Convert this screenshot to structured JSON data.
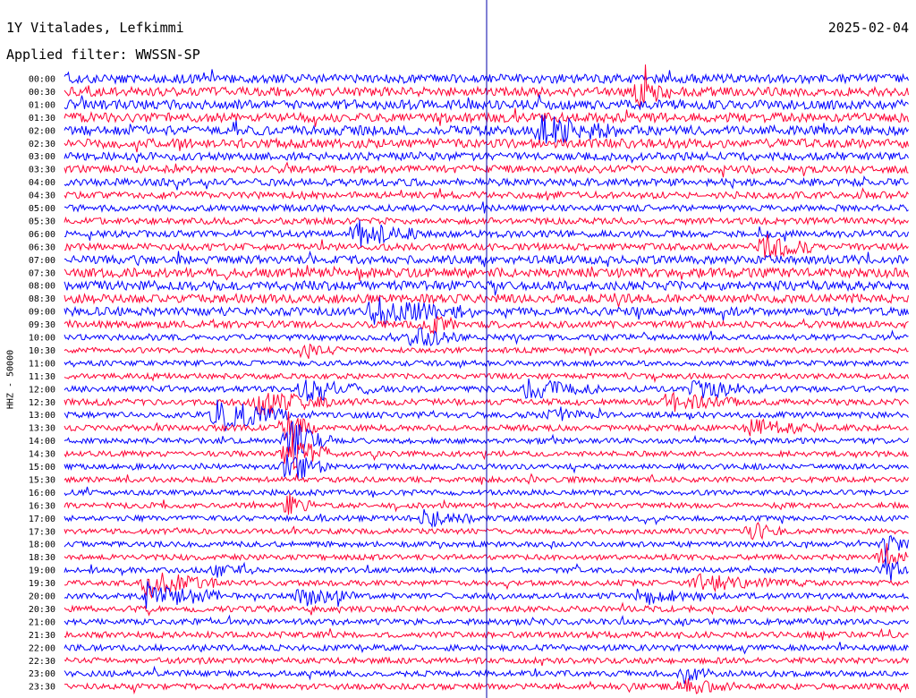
{
  "header": {
    "station": "1Y Vitalades, Lefkimmi",
    "date": "2025-02-04",
    "filter": "Applied filter: WWSSN-SP"
  },
  "chart_data": {
    "type": "line",
    "title": "1Y Vitalades, Lefkimmi",
    "ylabel": "HHZ - 50000",
    "row_labels": [
      "00:00",
      "00:30",
      "01:00",
      "01:30",
      "02:00",
      "02:30",
      "03:00",
      "03:30",
      "04:00",
      "04:30",
      "05:00",
      "05:30",
      "06:00",
      "06:30",
      "07:00",
      "07:30",
      "08:00",
      "08:30",
      "09:00",
      "09:30",
      "10:00",
      "10:30",
      "11:00",
      "11:30",
      "12:00",
      "12:30",
      "13:00",
      "13:30",
      "14:00",
      "14:30",
      "15:00",
      "15:30",
      "16:00",
      "16:30",
      "17:00",
      "17:30",
      "18:00",
      "18:30",
      "19:00",
      "19:30",
      "20:00",
      "20:30",
      "21:00",
      "21:30",
      "22:00",
      "22:30",
      "23:00",
      "23:30"
    ],
    "trace_colors": [
      "#0000ff",
      "#ff0033"
    ],
    "minutes_per_row": 30,
    "marker_minute": 15,
    "noise_level": [
      0.9,
      0.9,
      0.95,
      0.95,
      0.95,
      0.95,
      0.8,
      0.75,
      0.75,
      0.7,
      0.65,
      0.65,
      0.7,
      0.7,
      0.85,
      0.95,
      0.95,
      0.9,
      0.85,
      0.7,
      0.6,
      0.55,
      0.55,
      0.55,
      0.6,
      0.65,
      0.6,
      0.6,
      0.55,
      0.55,
      0.55,
      0.55,
      0.55,
      0.55,
      0.55,
      0.55,
      0.55,
      0.55,
      0.55,
      0.55,
      0.6,
      0.6,
      0.6,
      0.6,
      0.6,
      0.6,
      0.6,
      0.6
    ],
    "events": [
      {
        "row": 1,
        "minute": 20.5,
        "duration": 1.2,
        "amp": 1.6
      },
      {
        "row": 4,
        "minute": 17.0,
        "duration": 2.8,
        "amp": 1.6
      },
      {
        "row": 12,
        "minute": 10.5,
        "duration": 2.0,
        "amp": 1.8
      },
      {
        "row": 13,
        "minute": 24.8,
        "duration": 2.0,
        "amp": 1.4
      },
      {
        "row": 18,
        "minute": 11.0,
        "duration": 3.5,
        "amp": 1.5
      },
      {
        "row": 19,
        "minute": 13.0,
        "duration": 1.0,
        "amp": 1.2
      },
      {
        "row": 20,
        "minute": 12.5,
        "duration": 1.5,
        "amp": 1.4
      },
      {
        "row": 21,
        "minute": 8.5,
        "duration": 1.5,
        "amp": 1.0
      },
      {
        "row": 24,
        "minute": 8.5,
        "duration": 2.5,
        "amp": 1.4
      },
      {
        "row": 24,
        "minute": 16.5,
        "duration": 2.5,
        "amp": 1.2
      },
      {
        "row": 24,
        "minute": 22.5,
        "duration": 2.5,
        "amp": 1.1
      },
      {
        "row": 25,
        "minute": 7.0,
        "duration": 2.5,
        "amp": 1.5
      },
      {
        "row": 25,
        "minute": 21.5,
        "duration": 2.5,
        "amp": 1.0
      },
      {
        "row": 26,
        "minute": 5.5,
        "duration": 2.5,
        "amp": 2.0
      },
      {
        "row": 26,
        "minute": 17.5,
        "duration": 1.0,
        "amp": 1.0
      },
      {
        "row": 27,
        "minute": 8.0,
        "duration": 1.0,
        "amp": 2.4
      },
      {
        "row": 27,
        "minute": 24.5,
        "duration": 2.5,
        "amp": 1.0
      },
      {
        "row": 28,
        "minute": 8.0,
        "duration": 1.5,
        "amp": 2.6
      },
      {
        "row": 29,
        "minute": 8.0,
        "duration": 1.5,
        "amp": 2.6
      },
      {
        "row": 30,
        "minute": 8.0,
        "duration": 1.5,
        "amp": 2.0
      },
      {
        "row": 33,
        "minute": 8.0,
        "duration": 1.0,
        "amp": 1.2
      },
      {
        "row": 34,
        "minute": 12.8,
        "duration": 2.0,
        "amp": 1.0
      },
      {
        "row": 35,
        "minute": 24.5,
        "duration": 1.0,
        "amp": 1.0
      },
      {
        "row": 36,
        "minute": 29.2,
        "duration": 0.8,
        "amp": 1.4
      },
      {
        "row": 37,
        "minute": 29.2,
        "duration": 0.8,
        "amp": 1.6
      },
      {
        "row": 38,
        "minute": 29.2,
        "duration": 0.8,
        "amp": 1.8
      },
      {
        "row": 38,
        "minute": 5.5,
        "duration": 1.2,
        "amp": 0.8
      },
      {
        "row": 39,
        "minute": 3.0,
        "duration": 2.5,
        "amp": 1.6
      },
      {
        "row": 39,
        "minute": 22.5,
        "duration": 4.0,
        "amp": 0.9
      },
      {
        "row": 40,
        "minute": 3.0,
        "duration": 2.5,
        "amp": 1.8
      },
      {
        "row": 40,
        "minute": 8.5,
        "duration": 2.0,
        "amp": 1.0
      },
      {
        "row": 40,
        "minute": 20.5,
        "duration": 2.0,
        "amp": 1.0
      },
      {
        "row": 46,
        "minute": 22.0,
        "duration": 1.0,
        "amp": 1.0
      },
      {
        "row": 47,
        "minute": 22.0,
        "duration": 2.0,
        "amp": 0.8
      }
    ]
  }
}
